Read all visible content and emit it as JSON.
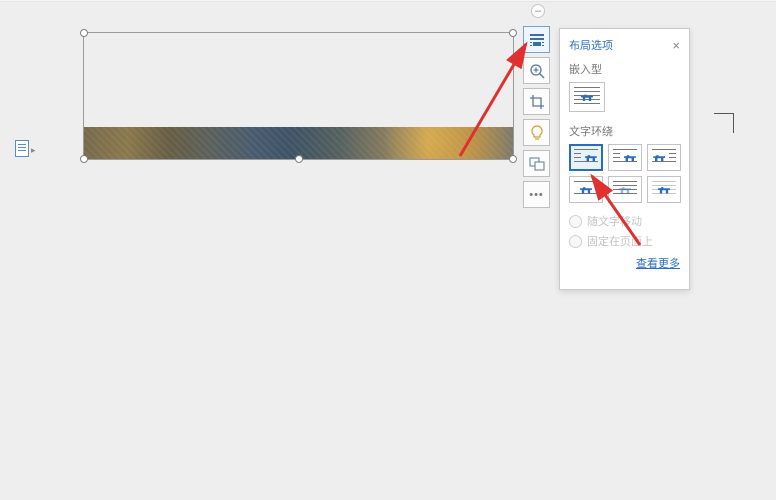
{
  "collapse_glyph": "–",
  "panel": {
    "title": "布局选项",
    "close_glyph": "×",
    "inline_label": "嵌入型",
    "wrap_label": "文字环绕",
    "radios": {
      "move_with_text": "随文字移动",
      "fix_on_page": "固定在页面上"
    },
    "see_more": "查看更多"
  },
  "tools": {
    "layout": "layout-options",
    "zoom": "zoom",
    "crop": "crop",
    "idea": "design-ideas",
    "alt": "alt-text",
    "more": "more"
  }
}
